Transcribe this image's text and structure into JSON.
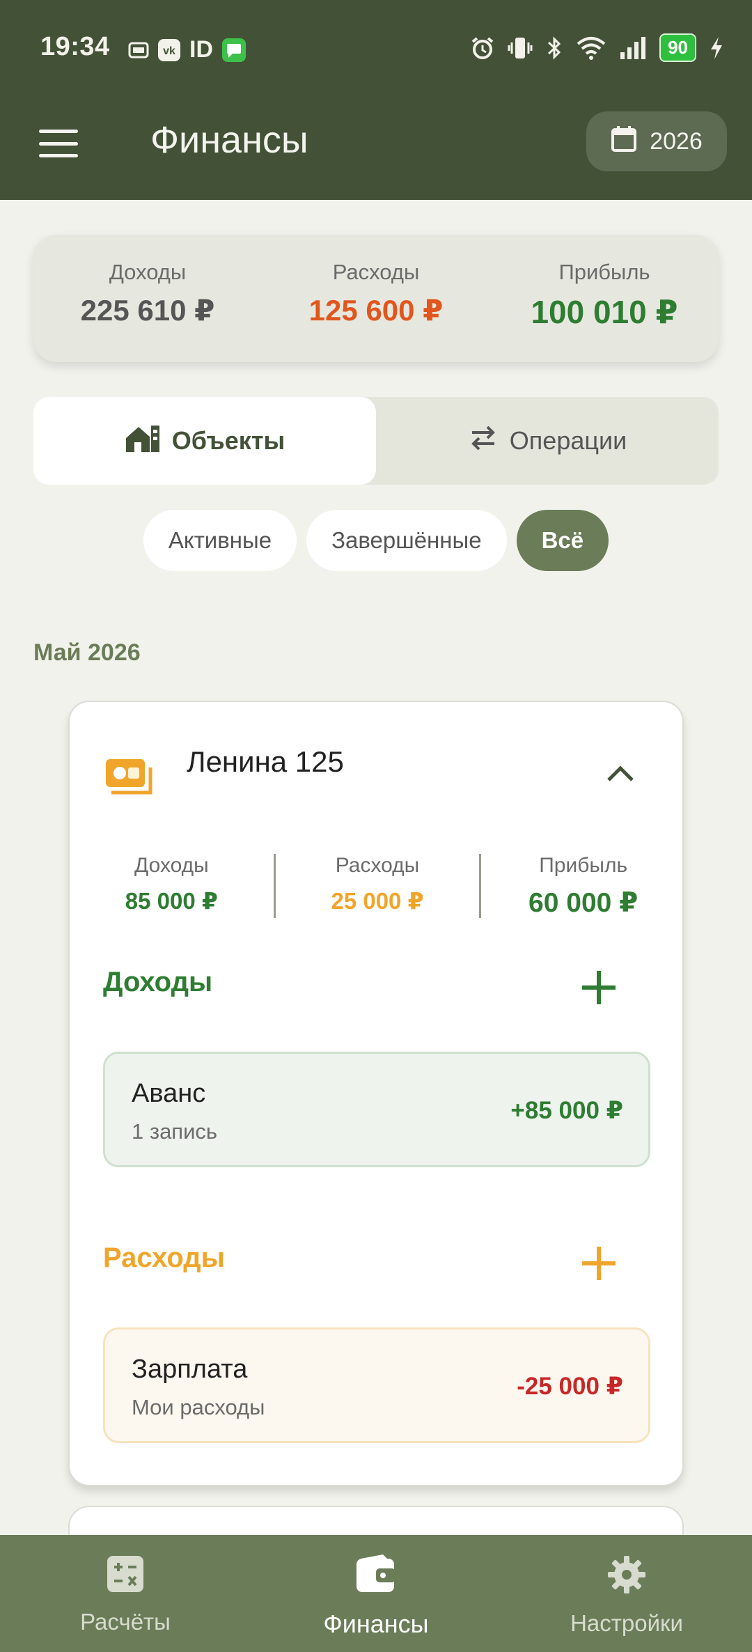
{
  "status_bar": {
    "time": "19:34",
    "battery": "90",
    "icons": [
      "pzh-app-icon",
      "vk-icon",
      "id-icon",
      "messages-icon",
      "alarm-icon",
      "vibrate-icon",
      "bluetooth-icon",
      "wifi-icon",
      "signal-icon",
      "charging-icon"
    ]
  },
  "app_bar": {
    "title": "Финансы",
    "year": "2026"
  },
  "summary": {
    "income": {
      "label": "Доходы",
      "value": "225 610 ₽",
      "color": "#555555"
    },
    "expense": {
      "label": "Расходы",
      "value": "125 600 ₽",
      "color": "#e0561e"
    },
    "profit": {
      "label": "Прибыль",
      "value": "100 010 ₽",
      "color": "#2e7d32"
    }
  },
  "tabs": [
    {
      "label": "Объекты",
      "icon": "house-icon",
      "active": true
    },
    {
      "label": "Операции",
      "icon": "swap-icon",
      "active": false
    }
  ],
  "filters": [
    {
      "label": "Активные",
      "active": false
    },
    {
      "label": "Завершённые",
      "active": false
    },
    {
      "label": "Всё",
      "active": true
    }
  ],
  "month_header": "Май 2026",
  "object": {
    "title": "Ленина 125",
    "stats": {
      "income": {
        "label": "Доходы",
        "value": "85 000 ₽"
      },
      "expense": {
        "label": "Расходы",
        "value": "25 000 ₽"
      },
      "profit": {
        "label": "Прибыль",
        "value": "60 000 ₽"
      }
    },
    "income_section": {
      "title": "Доходы",
      "entries": [
        {
          "name": "Аванс",
          "sub": "1 запись",
          "amount": "+85 000 ₽"
        }
      ]
    },
    "expense_section": {
      "title": "Расходы",
      "entries": [
        {
          "name": "Зарплата",
          "sub": "Мои расходы",
          "amount": "-25 000 ₽"
        }
      ]
    }
  },
  "bottom_nav": [
    {
      "label": "Расчёты",
      "icon": "calculator-icon",
      "active": false
    },
    {
      "label": "Финансы",
      "icon": "wallet-icon",
      "active": true
    },
    {
      "label": "Настройки",
      "icon": "settings-gear-icon",
      "active": false
    }
  ],
  "colors": {
    "header_bg": "#435237",
    "accent": "#6b7c58",
    "income_green": "#2e7d32",
    "expense_orange": "#f0a52a",
    "expense_red": "#c62828"
  }
}
